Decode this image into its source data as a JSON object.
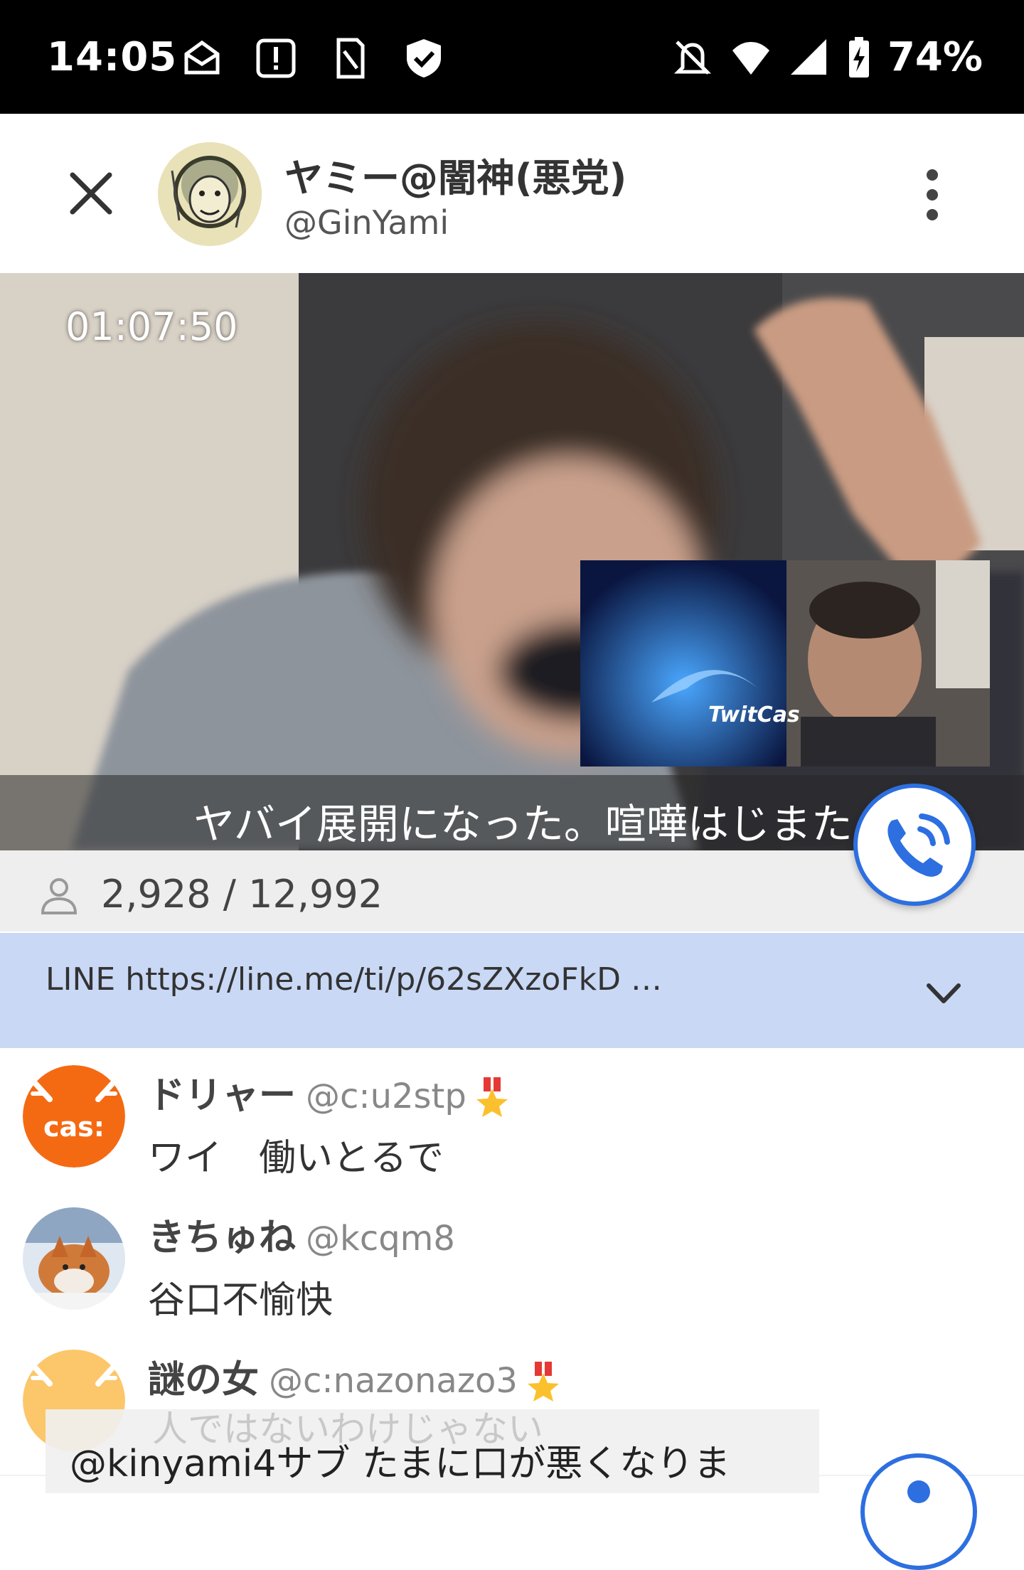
{
  "status_bar": {
    "time": "14:05",
    "battery": "74%",
    "left_icons": [
      "mail-icon",
      "alert-box-icon",
      "sim-card-icon",
      "shield-check-icon"
    ],
    "right_icons": [
      "bell-off-icon",
      "wifi-icon",
      "signal-icon",
      "battery-charging-icon"
    ]
  },
  "header": {
    "name": "ヤミー@闇神(悪党)",
    "handle": "@GinYami"
  },
  "video": {
    "timer": "01:07:50",
    "caption": "ヤバイ展開になった。喧嘩はじまた",
    "pip_label": "TwitCas"
  },
  "viewers": {
    "count": "2,928 / 12,992"
  },
  "notice": {
    "text": "LINE https://line.me/ti/p/62sZXzoFkD …"
  },
  "comments": [
    {
      "name": "ドリャー",
      "handle": "@c:u2stp",
      "text": "ワイ　働いとるで",
      "badge": true,
      "avatar": "cas"
    },
    {
      "name": "きちゅね",
      "handle": "@kcqm8",
      "text": "谷口不愉快",
      "badge": false,
      "avatar": "fox"
    },
    {
      "name": "謎の女",
      "handle": "@c:nazonazo3",
      "text": "人ではないわけじゃない",
      "badge": true,
      "avatar": "cas-light"
    }
  ],
  "overlay": {
    "text": "@kinyami4サブ たまに口が悪くなりま"
  },
  "colors": {
    "accent": "#2d6fe0",
    "notice_bg": "#c9d8f5",
    "cas_orange": "#f46a13"
  }
}
